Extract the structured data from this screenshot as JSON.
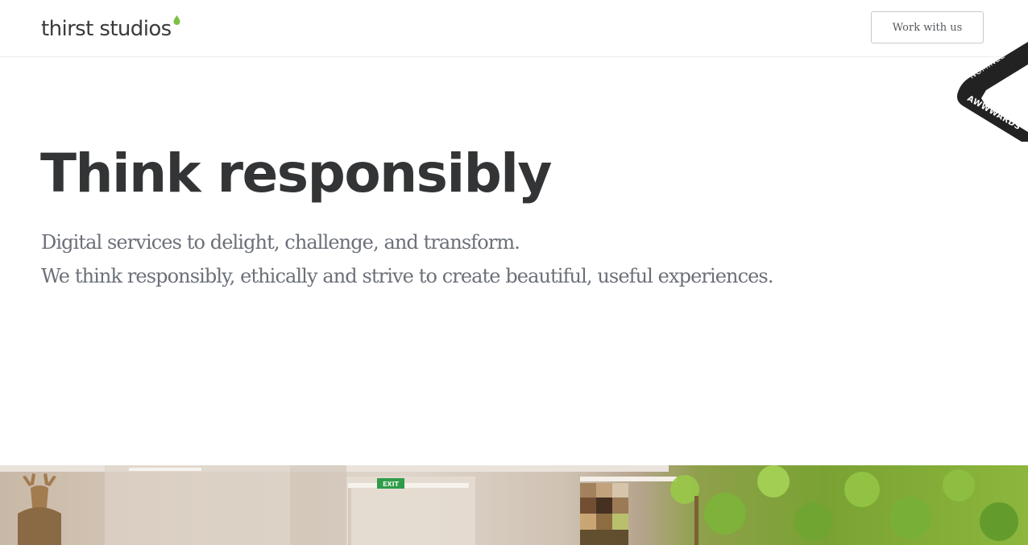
{
  "header": {
    "logo_text": "thirst studios",
    "cta_label": "Work with us"
  },
  "badge": {
    "line1": "NOMINEE",
    "line2": "AWWWARDS"
  },
  "hero": {
    "title": "Think responsibly",
    "subtitle_lines": [
      "Digital services to delight, challenge, and transform.",
      "We think responsibly, ethically and strive to create beautiful, useful experiences."
    ]
  },
  "photo": {
    "exit_sign": "EXIT"
  },
  "colors": {
    "accent_green": "#7bc142",
    "text_dark": "#333436",
    "text_muted": "#6b7078",
    "ribbon": "#222222"
  }
}
